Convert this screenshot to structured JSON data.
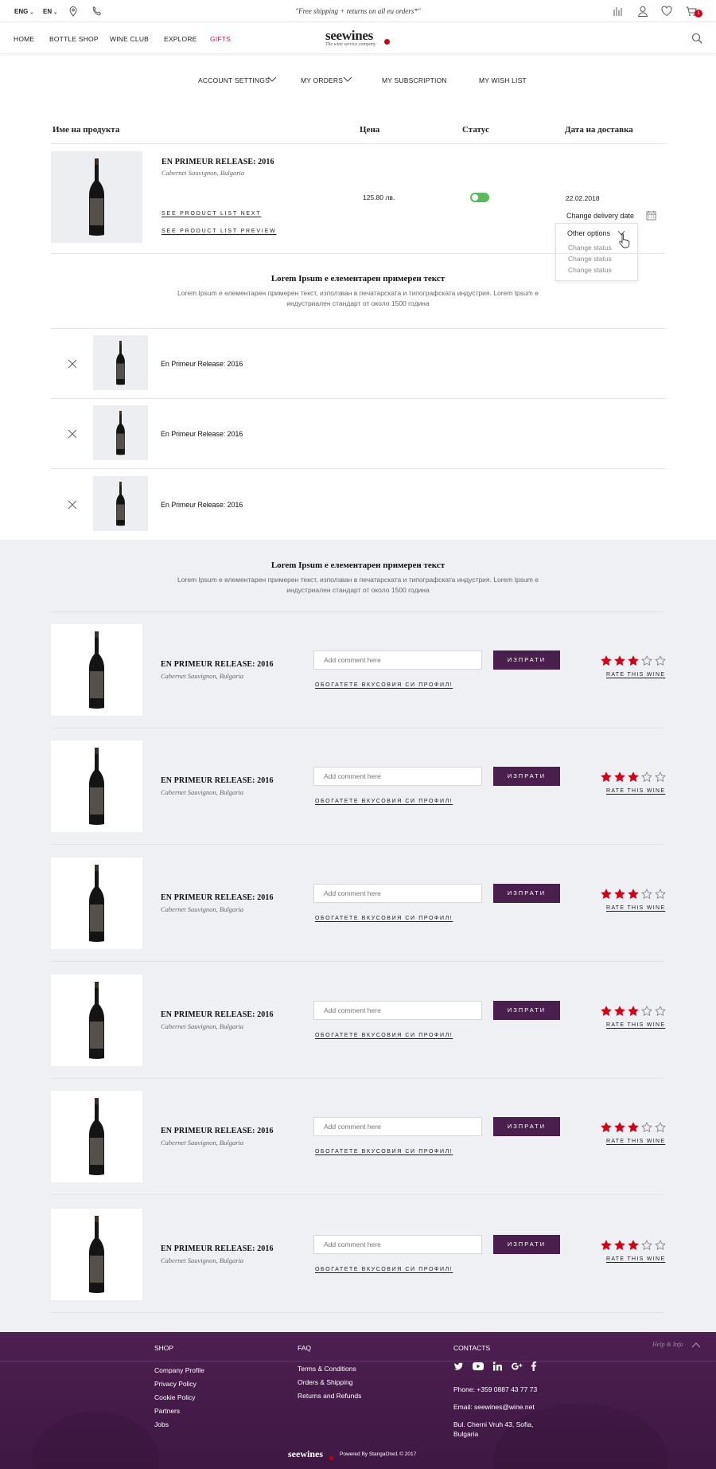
{
  "topbar": {
    "lang1": "ENG",
    "lang2": "EN",
    "promo": "\"Free shipping + returns on all eu orders*\"",
    "cart_count": "1"
  },
  "nav": {
    "home": "HOME",
    "bottle_shop": "BOTTLE SHOP",
    "wine_club": "WINE CLUB",
    "explore": "EXPLORE",
    "gifts": "GIFTS",
    "logo": "seewines",
    "logo_tag": "The wine service company"
  },
  "account": {
    "settings": "ACCOUNT SETTINGS",
    "orders": "MY ORDERS",
    "subscription": "MY SUBSCRIPTION",
    "wishlist": "MY WISH LIST"
  },
  "table": {
    "col_product": "Име на продукта",
    "col_price": "Цена",
    "col_status": "Статус",
    "col_delivery": "Дата на доставка"
  },
  "order": {
    "title": "EN PRIMEUR RELEASE: 2016",
    "subtitle": "Cabernet Sauvignon, Bulgaria",
    "link_next": "SEE PRODUCT LIST NEXT",
    "link_preview": "SEE PRODUCT LIST PREVIEW",
    "price": "125.80 лв.",
    "status_on": true,
    "date": "22.02.2018",
    "change_date": "Change delivery date",
    "dropdown": {
      "header": "Other options",
      "items": [
        "Change status",
        "Change status",
        "Change status"
      ]
    }
  },
  "section1": {
    "title": "Lorem Ipsum е елементарен примерен текст",
    "text": "Lorem Ipsum е елементарен примерен текст, използван в печатарската и типографската индустрия. Lorem Ipsum е индустриален стандарт от около 1500 година"
  },
  "list_items": [
    {
      "title": "En Primeur Release: 2016"
    },
    {
      "title": "En Primeur Release: 2016"
    },
    {
      "title": "En Primeur Release: 2016"
    }
  ],
  "section2": {
    "title": "Lorem Ipsum е елементарен примерен текст",
    "text": "Lorem Ipsum е елементарен примерен текст, използван в печатарската и типографската индустрия. Lorem Ipsum е индустриален стандарт от около 1500 година"
  },
  "review_items": [
    {
      "title": "EN PRIMEUR RELEASE: 2016",
      "subtitle": "Cabernet Sauvignon, Bulgaria",
      "placeholder": "Add comment here",
      "send": "ИЗПРАТИ",
      "enrich": "ОБОГАТЕТЕ ВКУСОВИЯ СИ ПРОФИЛ!",
      "rating": 3,
      "rate_label": "RATE THIS WINE"
    },
    {
      "title": "EN PRIMEUR RELEASE: 2016",
      "subtitle": "Cabernet Sauvignon, Bulgaria",
      "placeholder": "Add comment here",
      "send": "ИЗПРАТИ",
      "enrich": "ОБОГАТЕТЕ ВКУСОВИЯ СИ ПРОФИЛ!",
      "rating": 3,
      "rate_label": "RATE THIS WINE"
    },
    {
      "title": "EN PRIMEUR RELEASE: 2016",
      "subtitle": "Cabernet Sauvignon, Bulgaria",
      "placeholder": "Add comment here",
      "send": "ИЗПРАТИ",
      "enrich": "ОБОГАТЕТЕ ВКУСОВИЯ СИ ПРОФИЛ!",
      "rating": 3,
      "rate_label": "RATE THIS WINE"
    },
    {
      "title": "EN PRIMEUR RELEASE: 2016",
      "subtitle": "Cabernet Sauvignon, Bulgaria",
      "placeholder": "Add comment here",
      "send": "ИЗПРАТИ",
      "enrich": "ОБОГАТЕТЕ ВКУСОВИЯ СИ ПРОФИЛ!",
      "rating": 3,
      "rate_label": "RATE THIS WINE"
    },
    {
      "title": "EN PRIMEUR RELEASE: 2016",
      "subtitle": "Cabernet Sauvignon, Bulgaria",
      "placeholder": "Add comment here",
      "send": "ИЗПРАТИ",
      "enrich": "ОБОГАТЕТЕ ВКУСОВИЯ СИ ПРОФИЛ!",
      "rating": 3,
      "rate_label": "RATE THIS WINE"
    },
    {
      "title": "EN PRIMEUR RELEASE: 2016",
      "subtitle": "Cabernet Sauvignon, Bulgaria",
      "placeholder": "Add comment here",
      "send": "ИЗПРАТИ",
      "enrich": "ОБОГАТЕТЕ ВКУСОВИЯ СИ ПРОФИЛ!",
      "rating": 3,
      "rate_label": "RATE THIS WINE"
    }
  ],
  "footer": {
    "help": "Help & Info",
    "shop_title": "SHOP",
    "shop_links": [
      "Company Profile",
      "Privacy Policy",
      "Cookie Policy",
      "Partners",
      "Jobs"
    ],
    "faq_title": "FAQ",
    "faq_links": [
      "Terms & Conditions",
      "Orders & Shipping",
      "Returns and Refunds"
    ],
    "contacts_title": "CONTACTS",
    "phone": "Phone: +359 0887 43 77  73",
    "email": "Email: seewines@wine.net",
    "address1": "Bul. Cherni Vruh 43, Sofia,",
    "address2": "Bulgaria",
    "logo": "seewines",
    "powered": "Powered By StangaOne1 © 2017"
  },
  "colors": {
    "accent": "#4a1f4e",
    "gift": "#c2185b",
    "star": "#d0021b",
    "toggle": "#5cb85c",
    "grey_bg": "#eef0f4"
  }
}
